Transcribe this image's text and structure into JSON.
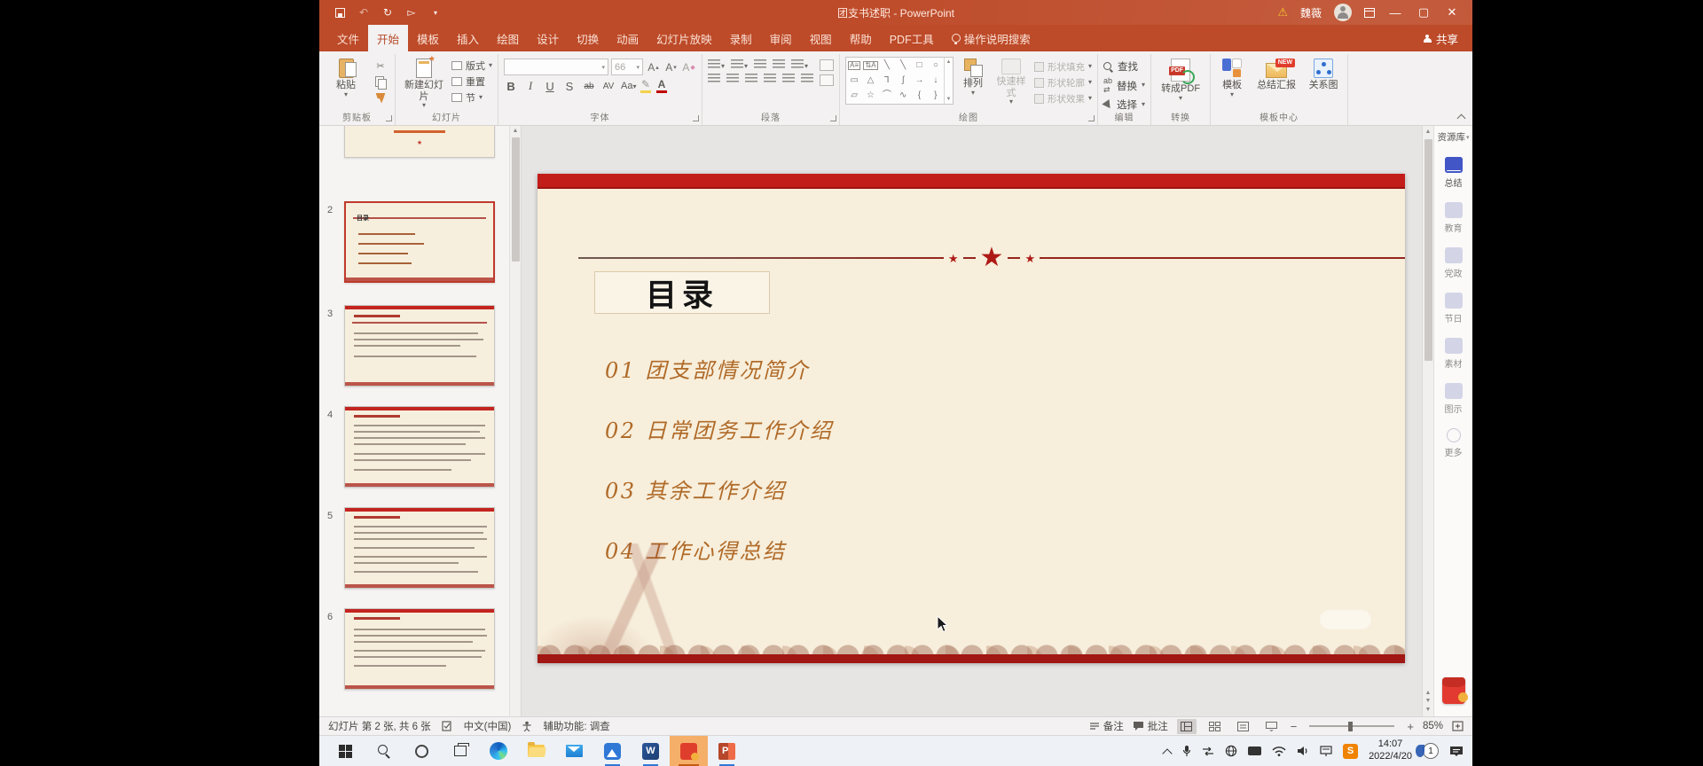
{
  "window": {
    "title": "团支书述职 - PowerPoint",
    "user_name": "魏薇"
  },
  "menu": {
    "tabs": [
      "文件",
      "开始",
      "模板",
      "插入",
      "绘图",
      "设计",
      "切换",
      "动画",
      "幻灯片放映",
      "录制",
      "审阅",
      "视图",
      "帮助",
      "PDF工具",
      "操作说明搜索"
    ],
    "active_tab": "开始",
    "share": "共享"
  },
  "ribbon": {
    "clipboard": {
      "group": "剪贴板",
      "paste": "粘贴"
    },
    "slides": {
      "group": "幻灯片",
      "new_slide": "新建幻灯片",
      "layout": "版式",
      "reset": "重置",
      "section": "节"
    },
    "font": {
      "group": "字体",
      "font_size": "66"
    },
    "paragraph": {
      "group": "段落"
    },
    "drawing": {
      "group": "绘图",
      "arrange": "排列",
      "quick_styles": "快速样式",
      "shape_fill": "形状填充",
      "shape_outline": "形状轮廓",
      "shape_effects": "形状效果"
    },
    "editing": {
      "group": "编辑",
      "find": "查找",
      "replace": "替换",
      "select": "选择"
    },
    "convert": {
      "group": "转换",
      "to_pdf": "转成PDF"
    },
    "template_center": {
      "group": "模板中心",
      "template": "模板",
      "summary_report": "总结汇报",
      "new_badge": "NEW",
      "diagram": "关系图"
    }
  },
  "thumbnail_panel": {
    "slide_numbers": [
      "2",
      "3",
      "4",
      "5",
      "6"
    ],
    "selected_slide": "2"
  },
  "slide": {
    "title": "目录",
    "items": [
      {
        "no": "01",
        "text": "团支部情况简介"
      },
      {
        "no": "02",
        "text": "日常团务工作介绍"
      },
      {
        "no": "03",
        "text": "其余工作介绍"
      },
      {
        "no": "04",
        "text": "工作心得总结"
      }
    ]
  },
  "resource_panel": {
    "title": "资源库",
    "items": [
      "总结",
      "教育",
      "党政",
      "节日",
      "素材",
      "图示",
      "更多"
    ],
    "active_item": "总结"
  },
  "status_bar": {
    "slide_info": "幻灯片 第 2 张, 共 6 张",
    "language": "中文(中国)",
    "accessibility": "辅助功能: 调查",
    "notes": "备注",
    "comments": "批注",
    "zoom_level": "85%"
  },
  "taskbar": {
    "time": "14:07",
    "date": "2022/4/20",
    "badge_count": "1"
  },
  "colors": {
    "titlebar_orange": "#BD4A28",
    "slide_cream": "#F7EEDB",
    "banner_red": "#C31D1A",
    "bottom_red": "#A11713",
    "toc_brown": "#B06A28",
    "star_red": "#AD1A16"
  }
}
